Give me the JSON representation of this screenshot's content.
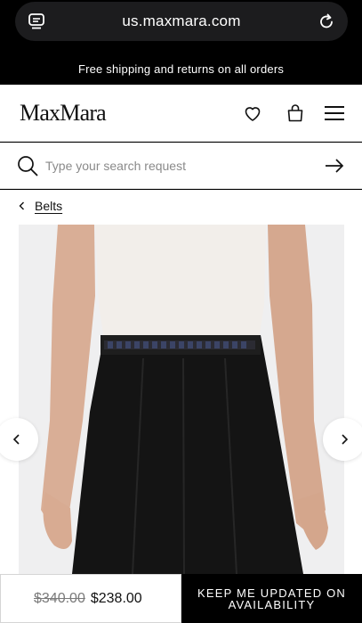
{
  "browser": {
    "url": "us.maxmara.com"
  },
  "promo": {
    "text": "Free shipping and returns on all orders"
  },
  "header": {
    "logo": "MaxMara"
  },
  "search": {
    "placeholder": "Type your search request"
  },
  "breadcrumb": {
    "label": "Belts"
  },
  "product": {
    "old_price": "$340.00",
    "price": "$238.00",
    "cta": "KEEP ME UPDATED ON AVAILABILITY"
  },
  "colors": {
    "brand": "#000000",
    "surface": "#ffffff",
    "muted": "#7a7a7a"
  }
}
